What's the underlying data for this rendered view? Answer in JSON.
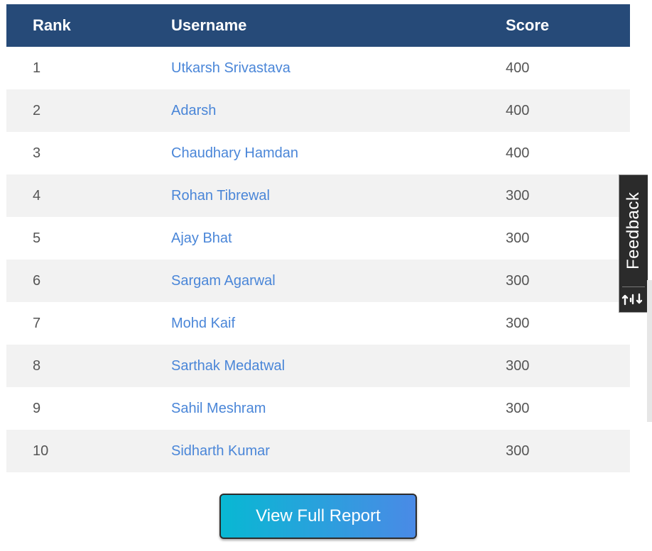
{
  "table": {
    "headers": {
      "rank": "Rank",
      "username": "Username",
      "score": "Score"
    },
    "rows": [
      {
        "rank": "1",
        "username": "Utkarsh Srivastava",
        "score": "400"
      },
      {
        "rank": "2",
        "username": "Adarsh",
        "score": "400"
      },
      {
        "rank": "3",
        "username": "Chaudhary Hamdan",
        "score": "400"
      },
      {
        "rank": "4",
        "username": "Rohan Tibrewal",
        "score": "300"
      },
      {
        "rank": "5",
        "username": "Ajay Bhat",
        "score": "300"
      },
      {
        "rank": "6",
        "username": "Sargam Agarwal",
        "score": "300"
      },
      {
        "rank": "7",
        "username": "Mohd Kaif",
        "score": "300"
      },
      {
        "rank": "8",
        "username": "Sarthak Medatwal",
        "score": "300"
      },
      {
        "rank": "9",
        "username": "Sahil Meshram",
        "score": "300"
      },
      {
        "rank": "10",
        "username": "Sidharth Kumar",
        "score": "300"
      }
    ]
  },
  "actions": {
    "view_report_label": "View Full Report"
  },
  "feedback": {
    "label": "Feedback",
    "icon": "sort-arrows-icon"
  },
  "colors": {
    "header_bg": "#264a78",
    "link": "#4a86d8",
    "stripe": "#f2f2f2",
    "button_gradient_start": "#08b8d3",
    "button_gradient_end": "#4a8ae6",
    "feedback_bg": "#2b2b2b"
  }
}
